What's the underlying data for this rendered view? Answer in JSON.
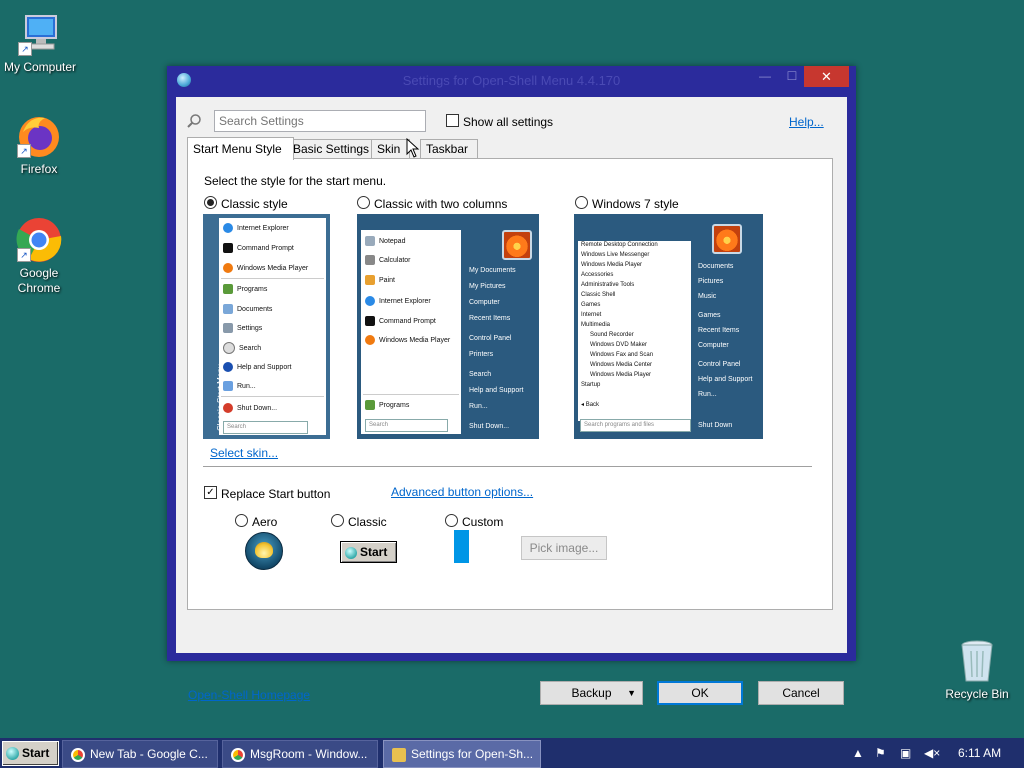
{
  "desktop": {
    "icons": [
      {
        "label": "My Computer"
      },
      {
        "label": "Firefox"
      },
      {
        "label": "Google Chrome"
      },
      {
        "label": "Recycle Bin"
      }
    ]
  },
  "window": {
    "title": "Settings for Open-Shell Menu 4.4.170",
    "search_placeholder": "Search Settings",
    "show_all_label": "Show all settings",
    "help_label": "Help...",
    "tabs": [
      "Start Menu Style",
      "Basic Settings",
      "Skin",
      "Taskbar"
    ],
    "active_tab": "Start Menu Style",
    "prompt": "Select the style for the start menu.",
    "styles": [
      {
        "label": "Classic style",
        "selected": true
      },
      {
        "label": "Classic with two columns",
        "selected": false
      },
      {
        "label": "Windows 7 style",
        "selected": false
      }
    ],
    "preview_classic": {
      "items": [
        "Internet Explorer",
        "Command Prompt",
        "Windows Media Player",
        "Programs",
        "Documents",
        "Settings",
        "Search",
        "Help and Support",
        "Run...",
        "Shut Down..."
      ],
      "side_label": "Classic Start Menu",
      "search": "Search"
    },
    "preview_two": {
      "left_items": [
        "Notepad",
        "Calculator",
        "Paint",
        "Internet Explorer",
        "Command Prompt",
        "Windows Media Player"
      ],
      "programs": "Programs",
      "right_items": [
        "My Documents",
        "My Pictures",
        "Computer",
        "Recent Items",
        "Control Panel",
        "Printers",
        "Search",
        "Help and Support",
        "Run..."
      ],
      "shutdown": "Shut Down...",
      "search": "Search"
    },
    "preview_win7": {
      "left_items": [
        "Remote Desktop Connection",
        "Windows Live Messenger",
        "Windows Media Player",
        "Accessories",
        "Administrative Tools",
        "Classic Shell",
        "Games",
        "Internet",
        "Multimedia",
        "Sound Recorder",
        "Windows DVD Maker",
        "Windows Fax and Scan",
        "Windows Media Center",
        "Windows Media Player",
        "Startup"
      ],
      "back": "Back",
      "search": "Search programs and files",
      "right_items": [
        "Documents",
        "Pictures",
        "Music",
        "Games",
        "Recent Items",
        "Computer",
        "Control Panel",
        "Help and Support",
        "Run..."
      ],
      "shutdown": "Shut Down"
    },
    "select_skin": "Select skin...",
    "replace_start_label": "Replace Start button",
    "replace_start_checked": true,
    "advanced_button_options": "Advanced button options...",
    "button_styles": [
      {
        "label": "Aero",
        "selected": false
      },
      {
        "label": "Classic",
        "selected": false
      },
      {
        "label": "Custom",
        "selected": false
      }
    ],
    "classic_button_text": "Start",
    "pick_image": "Pick image...",
    "homepage": "Open-Shell Homepage",
    "backup": "Backup",
    "ok": "OK",
    "cancel": "Cancel"
  },
  "taskbar": {
    "start": "Start",
    "tasks": [
      {
        "label": "New Tab - Google C...",
        "active": false
      },
      {
        "label": "MsgRoom - Window...",
        "active": false
      },
      {
        "label": "Settings for Open-Sh...",
        "active": true
      }
    ],
    "clock": "6:11 AM"
  },
  "colors": {
    "desktop": "#1a6b68",
    "window_frame": "#2b2b9c",
    "close_button": "#c7372f",
    "link": "#0066cc",
    "taskbar": "#1f2f6d"
  }
}
